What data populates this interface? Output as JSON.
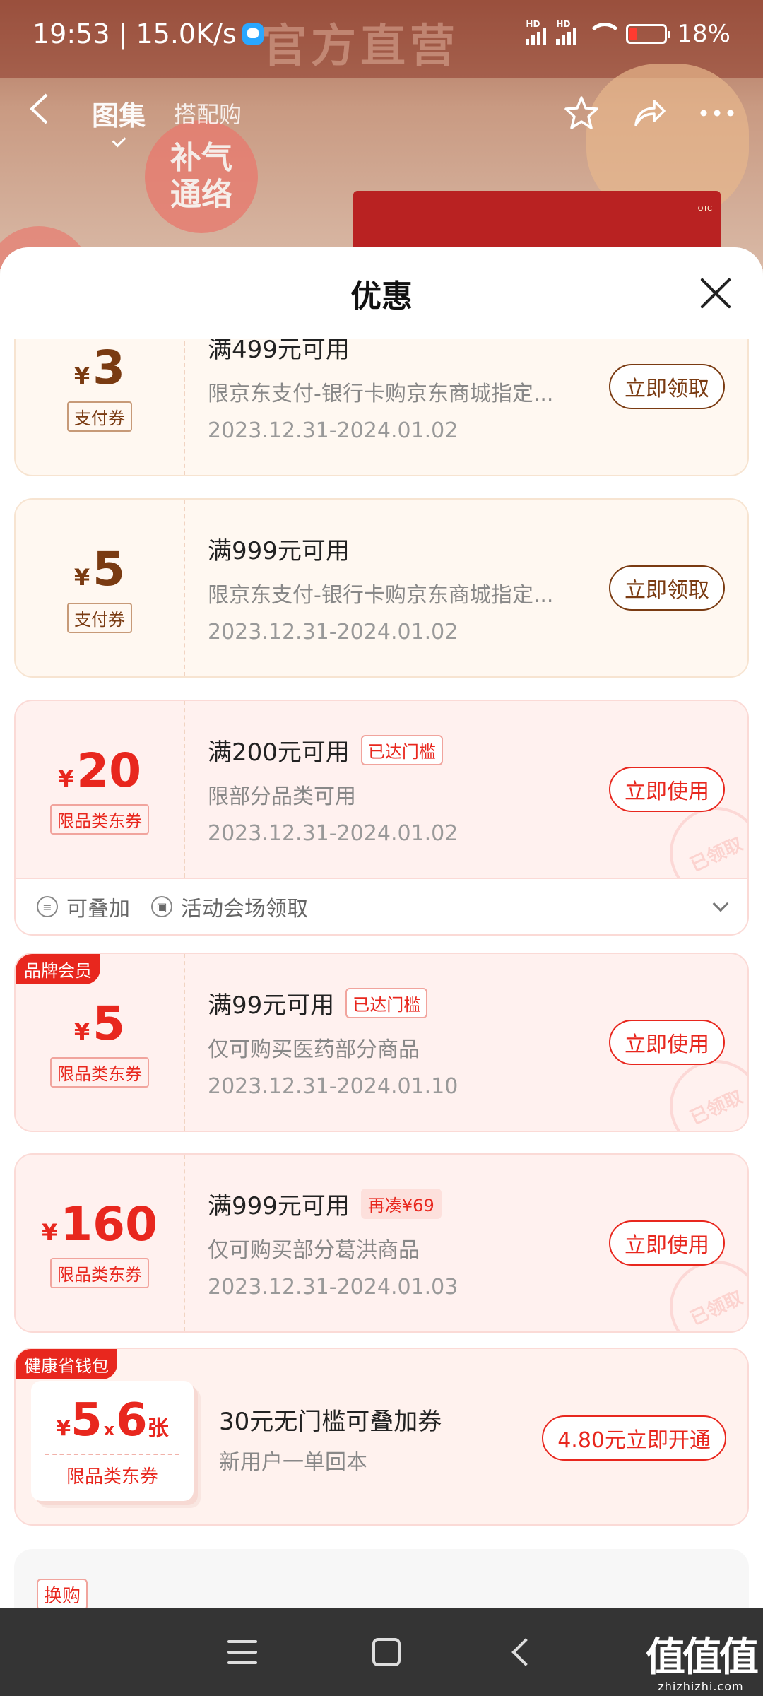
{
  "status_bar": {
    "time": "19:53",
    "net_speed": "15.0K/s",
    "battery": "18%",
    "sim1_label": "HD",
    "sim2_label": "HD",
    "wifi_label": "6"
  },
  "background": {
    "banner_text": "官方直营",
    "circle_text": "补气通络",
    "box_label": "OTC"
  },
  "nav": {
    "tabs": [
      {
        "label": "图集"
      },
      {
        "label": "搭配购"
      }
    ]
  },
  "sheet": {
    "title": "优惠"
  },
  "coupons": [
    {
      "yen": "¥",
      "amount": "3",
      "type": "支付券",
      "title": "满499元可用",
      "tag": "",
      "desc": "限京东支付-银行卡购京东商城指定...",
      "date": "2023.12.31-2024.01.02",
      "button": "立即领取"
    },
    {
      "yen": "¥",
      "amount": "5",
      "type": "支付券",
      "title": "满999元可用",
      "tag": "",
      "desc": "限京东支付-银行卡购京东商城指定...",
      "date": "2023.12.31-2024.01.02",
      "button": "立即领取"
    },
    {
      "yen": "¥",
      "amount": "20",
      "type": "限品类东券",
      "title": "满200元可用",
      "tag": "已达门槛",
      "desc": "限部分品类可用",
      "date": "2023.12.31-2024.01.02",
      "button": "立即使用",
      "stamp": "已领取"
    },
    {
      "yen": "¥",
      "amount": "5",
      "type": "限品类东券",
      "title": "满99元可用",
      "tag": "已达门槛",
      "desc": "仅可购买医药部分商品",
      "date": "2023.12.31-2024.01.10",
      "button": "立即使用",
      "stamp": "已领取",
      "corner": "品牌会员"
    },
    {
      "yen": "¥",
      "amount": "160",
      "type": "限品类东券",
      "title": "满999元可用",
      "tag": "再凑¥69",
      "desc": "仅可购买部分葛洪商品",
      "date": "2023.12.31-2024.01.03",
      "button": "立即使用",
      "stamp": "已领取"
    }
  ],
  "coupon3_footer": {
    "stackable": "可叠加",
    "source": "活动会场领取"
  },
  "wallet": {
    "corner": "健康省钱包",
    "yen": "¥",
    "amount": "5",
    "times": "x",
    "count": "6",
    "unit": "张",
    "type": "限品类东券",
    "title": "30元无门槛可叠加券",
    "subtitle": "新用户一单回本",
    "button": "4.80元立即开通"
  },
  "swap": {
    "tag": "换购"
  },
  "watermark": {
    "logo": "值值值",
    "url": "zhizhizhi.com"
  }
}
